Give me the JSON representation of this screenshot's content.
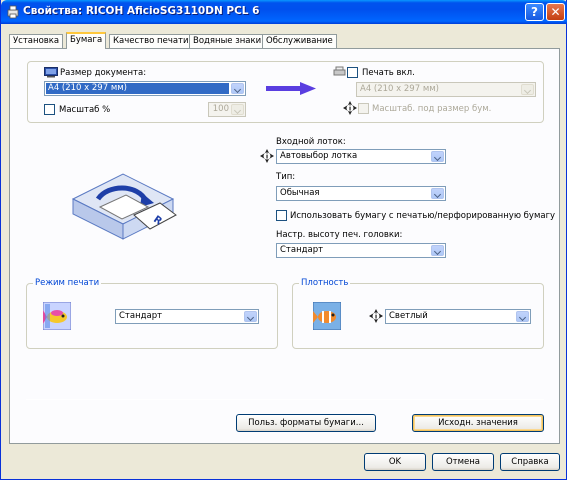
{
  "window": {
    "title": "Свойства: RICOH AficioSG3110DN PCL 6",
    "help_glyph": "?",
    "close_glyph": "✕"
  },
  "tabs": [
    {
      "label": "Установка"
    },
    {
      "label": "Бумага"
    },
    {
      "label": "Качество печати"
    },
    {
      "label": "Водяные знаки"
    },
    {
      "label": "Обслуживание"
    }
  ],
  "paper": {
    "doc_size_label": "Размер документа:",
    "doc_size_value": "A4 (210 x 297 мм)",
    "scale_label": "Масштаб %",
    "scale_value": "100",
    "print_on_label": "Печать вкл.",
    "print_on_value": "A4 (210 x 297 мм)",
    "fit_label": "Масштаб. под размер бум."
  },
  "input_tray": {
    "label": "Входной лоток:",
    "value": "Автовыбор лотка"
  },
  "type": {
    "label": "Тип:",
    "value": "Обычная"
  },
  "preprinted": {
    "label": "Использовать бумагу с печатью/перфорированную бумагу"
  },
  "head_height": {
    "label": "Настр. высоту печ. головки:",
    "value": "Стандарт"
  },
  "print_mode": {
    "group_title": "Режим печати",
    "value": "Стандарт"
  },
  "density": {
    "group_title": "Плотность",
    "value": "Светлый"
  },
  "buttons": {
    "custom_sizes": "Польз. форматы бумаги...",
    "defaults": "Исходн. значения",
    "ok": "OK",
    "cancel": "Отмена",
    "help": "Справка"
  },
  "colors": {
    "titlebar": "#0054e3",
    "group_title": "#0046d5",
    "selection": "#316ac5",
    "tab_highlight": "#ffc83c",
    "arrow": "#5a3ee0"
  }
}
